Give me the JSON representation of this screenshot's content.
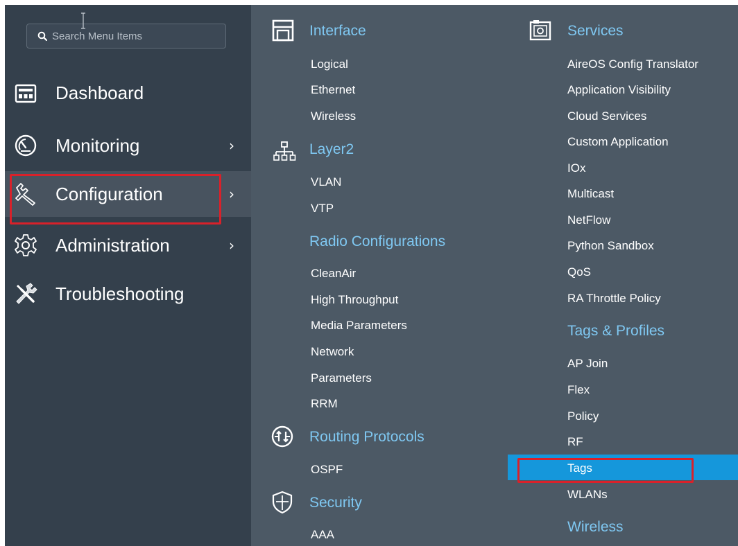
{
  "search": {
    "placeholder": "Search Menu Items"
  },
  "nav": {
    "items": [
      {
        "label": "Dashboard",
        "icon": "dashboard-icon",
        "has_submenu": false
      },
      {
        "label": "Monitoring",
        "icon": "gauge-icon",
        "has_submenu": true
      },
      {
        "label": "Configuration",
        "icon": "wrench-icon",
        "has_submenu": true,
        "selected": true
      },
      {
        "label": "Administration",
        "icon": "gear-icon",
        "has_submenu": true
      },
      {
        "label": "Troubleshooting",
        "icon": "tools-icon",
        "has_submenu": false
      }
    ],
    "chevron": "›"
  },
  "menu": {
    "interface": {
      "title": "Interface",
      "items": [
        "Logical",
        "Ethernet",
        "Wireless"
      ]
    },
    "layer2": {
      "title": "Layer2",
      "items": [
        "VLAN",
        "VTP"
      ]
    },
    "radio": {
      "title": "Radio Configurations",
      "items": [
        "CleanAir",
        "High Throughput",
        "Media Parameters",
        "Network",
        "Parameters",
        "RRM"
      ]
    },
    "routing": {
      "title": "Routing Protocols",
      "items": [
        "OSPF"
      ]
    },
    "security": {
      "title": "Security",
      "items": [
        "AAA"
      ]
    },
    "services": {
      "title": "Services",
      "items": [
        "AireOS Config Translator",
        "Application Visibility",
        "Cloud Services",
        "Custom Application",
        "IOx",
        "Multicast",
        "NetFlow",
        "Python Sandbox",
        "QoS",
        "RA Throttle Policy"
      ]
    },
    "tags_profiles": {
      "title": "Tags & Profiles",
      "items": [
        "AP Join",
        "Flex",
        "Policy",
        "RF",
        "Tags",
        "WLANs"
      ],
      "selected": "Tags"
    },
    "wireless": {
      "title": "Wireless"
    }
  },
  "colors": {
    "nav_bg": "#34404c",
    "panel_bg": "#4c5965",
    "section_heading": "#7fc8f2",
    "selected_item_bg": "#1597db",
    "highlight_border": "#d9212a"
  }
}
